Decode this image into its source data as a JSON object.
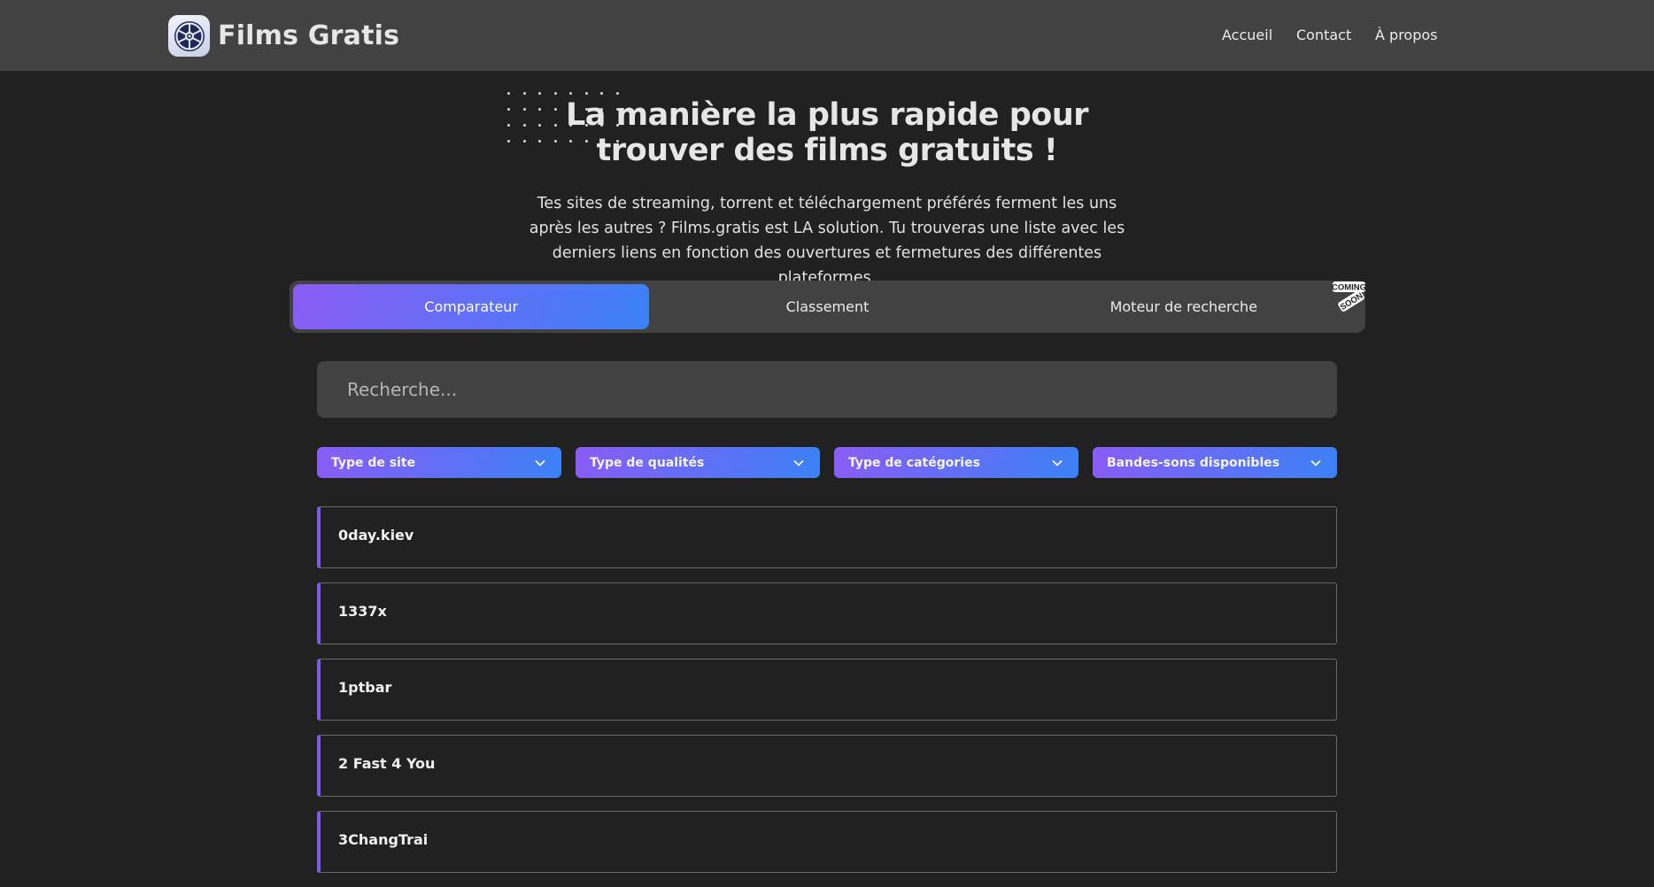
{
  "header": {
    "brand_name": "Films Gratis",
    "brand_icon": "film-reel-icon",
    "nav": [
      {
        "label": "Accueil"
      },
      {
        "label": "Contact"
      },
      {
        "label": "À propos"
      }
    ],
    "theme_toggle_icon": "moon-icon"
  },
  "hero": {
    "title": "La manière la plus rapide pour trouver des films gratuits !",
    "subtitle": "Tes sites de streaming, torrent et téléchargement préférés ferment les uns après les autres ? Films.gratis est LA solution. Tu trouveras une liste avec les derniers liens en fonction des ouvertures et fermetures des différentes plateformes."
  },
  "tabs": [
    {
      "label": "Comparateur",
      "active": true
    },
    {
      "label": "Classement",
      "active": false
    },
    {
      "label": "Moteur de recherche",
      "active": false,
      "badge": "COMING SOON"
    }
  ],
  "coming_soon": {
    "line1": "COMING",
    "line2": "SOON"
  },
  "search": {
    "placeholder": "Recherche...",
    "value": ""
  },
  "filters": [
    {
      "label": "Type de site"
    },
    {
      "label": "Type de qualités"
    },
    {
      "label": "Type de catégories"
    },
    {
      "label": "Bandes-sons disponibles"
    }
  ],
  "sites": [
    {
      "name": "0day.kiev"
    },
    {
      "name": "1337x"
    },
    {
      "name": "1ptbar"
    },
    {
      "name": "2 Fast 4 You"
    },
    {
      "name": "3ChangTrai"
    }
  ],
  "colors": {
    "gradient_start": "#8b5cf6",
    "gradient_end": "#3b82f6",
    "accent_border": "#7c5ce6",
    "background": "#212121",
    "surface": "#424242"
  }
}
